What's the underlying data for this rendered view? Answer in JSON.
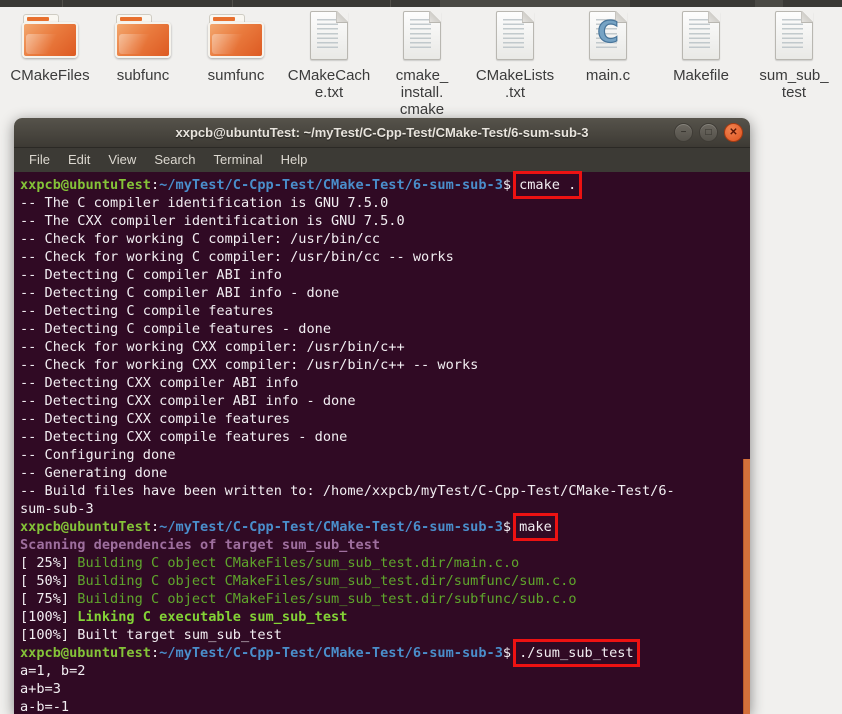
{
  "colors": {
    "desktop_bg": "#f1f0ee",
    "terminal_bg": "#300a24",
    "terminal_fg": "#f2eef2",
    "prompt_green": "#84c338",
    "path_blue": "#4a8ecb",
    "build_green": "#5fa62c",
    "bold_green": "#83d336",
    "magenta": "#9e6f9e",
    "annotation_red": "#ed1212",
    "scrollbar_orange": "#d3703b",
    "folder_orange": "#e4622c",
    "titlebar_dark": "#45423c"
  },
  "desktop": {
    "icons": [
      {
        "name": "CMakeFiles",
        "type": "folder",
        "label_lines": [
          "CMakeFiles"
        ]
      },
      {
        "name": "subfunc",
        "type": "folder",
        "label_lines": [
          "subfunc"
        ]
      },
      {
        "name": "sumfunc",
        "type": "folder",
        "label_lines": [
          "sumfunc"
        ]
      },
      {
        "name": "CMakeCache.txt",
        "type": "file",
        "label_lines": [
          "CMakeCach",
          "e.txt"
        ]
      },
      {
        "name": "cmake_install.cmake",
        "type": "file",
        "label_lines": [
          "cmake_",
          "install.",
          "cmake"
        ]
      },
      {
        "name": "CMakeLists.txt",
        "type": "file",
        "label_lines": [
          "CMakeLists",
          ".txt"
        ]
      },
      {
        "name": "main.c",
        "type": "file-c",
        "badge": "C",
        "label_lines": [
          "main.c"
        ]
      },
      {
        "name": "Makefile",
        "type": "file",
        "label_lines": [
          "Makefile"
        ]
      },
      {
        "name": "sum_sub_test",
        "type": "file",
        "label_lines": [
          "sum_sub_",
          "test"
        ]
      }
    ]
  },
  "terminal": {
    "title": "xxpcb@ubuntuTest: ~/myTest/C-Cpp-Test/CMake-Test/6-sum-sub-3",
    "window_buttons": [
      {
        "name": "minimize",
        "glyph": "−"
      },
      {
        "name": "maximize",
        "glyph": "□"
      },
      {
        "name": "close",
        "glyph": "✕"
      }
    ],
    "menu": [
      "File",
      "Edit",
      "View",
      "Search",
      "Terminal",
      "Help"
    ],
    "prompt": {
      "user": "xxpcb@ubuntuTest",
      "separator": ":",
      "path": "~/myTest/C-Cpp-Test/CMake-Test/6-sum-sub-3",
      "symbol": "$"
    },
    "commands": [
      "cmake .",
      "make",
      "./sum_sub_test"
    ],
    "lines": [
      {
        "s": [
          {
            "t": "xxpcb@ubuntuTest",
            "c": "user"
          },
          {
            "t": ":",
            "c": "plain"
          },
          {
            "t": "~/myTest/C-Cpp-Test/CMake-Test/6-sum-sub-3",
            "c": "path"
          },
          {
            "t": "$",
            "c": "plain"
          },
          {
            "t": "cmake .",
            "c": "cmd"
          }
        ]
      },
      {
        "s": [
          {
            "t": "-- The C compiler identification is GNU 7.5.0",
            "c": "plain"
          }
        ]
      },
      {
        "s": [
          {
            "t": "-- The CXX compiler identification is GNU 7.5.0",
            "c": "plain"
          }
        ]
      },
      {
        "s": [
          {
            "t": "-- Check for working C compiler: /usr/bin/cc",
            "c": "plain"
          }
        ]
      },
      {
        "s": [
          {
            "t": "-- Check for working C compiler: /usr/bin/cc -- works",
            "c": "plain"
          }
        ]
      },
      {
        "s": [
          {
            "t": "-- Detecting C compiler ABI info",
            "c": "plain"
          }
        ]
      },
      {
        "s": [
          {
            "t": "-- Detecting C compiler ABI info - done",
            "c": "plain"
          }
        ]
      },
      {
        "s": [
          {
            "t": "-- Detecting C compile features",
            "c": "plain"
          }
        ]
      },
      {
        "s": [
          {
            "t": "-- Detecting C compile features - done",
            "c": "plain"
          }
        ]
      },
      {
        "s": [
          {
            "t": "-- Check for working CXX compiler: /usr/bin/c++",
            "c": "plain"
          }
        ]
      },
      {
        "s": [
          {
            "t": "-- Check for working CXX compiler: /usr/bin/c++ -- works",
            "c": "plain"
          }
        ]
      },
      {
        "s": [
          {
            "t": "-- Detecting CXX compiler ABI info",
            "c": "plain"
          }
        ]
      },
      {
        "s": [
          {
            "t": "-- Detecting CXX compiler ABI info - done",
            "c": "plain"
          }
        ]
      },
      {
        "s": [
          {
            "t": "-- Detecting CXX compile features",
            "c": "plain"
          }
        ]
      },
      {
        "s": [
          {
            "t": "-- Detecting CXX compile features - done",
            "c": "plain"
          }
        ]
      },
      {
        "s": [
          {
            "t": "-- Configuring done",
            "c": "plain"
          }
        ]
      },
      {
        "s": [
          {
            "t": "-- Generating done",
            "c": "plain"
          }
        ]
      },
      {
        "s": [
          {
            "t": "-- Build files have been written to: /home/xxpcb/myTest/C-Cpp-Test/CMake-Test/6-",
            "c": "plain"
          }
        ]
      },
      {
        "s": [
          {
            "t": "sum-sub-3",
            "c": "plain"
          }
        ]
      },
      {
        "s": [
          {
            "t": "xxpcb@ubuntuTest",
            "c": "user"
          },
          {
            "t": ":",
            "c": "plain"
          },
          {
            "t": "~/myTest/C-Cpp-Test/CMake-Test/6-sum-sub-3",
            "c": "path"
          },
          {
            "t": "$",
            "c": "plain"
          },
          {
            "t": "make",
            "c": "cmd"
          }
        ]
      },
      {
        "s": [
          {
            "t": "Scanning dependencies of target sum_sub_test",
            "c": "magenta"
          }
        ]
      },
      {
        "s": [
          {
            "t": "[ 25%] ",
            "c": "plain"
          },
          {
            "t": "Building C object CMakeFiles/sum_sub_test.dir/main.c.o",
            "c": "green"
          }
        ]
      },
      {
        "s": [
          {
            "t": "[ 50%] ",
            "c": "plain"
          },
          {
            "t": "Building C object CMakeFiles/sum_sub_test.dir/sumfunc/sum.c.o",
            "c": "green"
          }
        ]
      },
      {
        "s": [
          {
            "t": "[ 75%] ",
            "c": "plain"
          },
          {
            "t": "Building C object CMakeFiles/sum_sub_test.dir/subfunc/sub.c.o",
            "c": "green"
          }
        ]
      },
      {
        "s": [
          {
            "t": "[100%] ",
            "c": "plain"
          },
          {
            "t": "Linking C executable sum_sub_test",
            "c": "greenb"
          }
        ]
      },
      {
        "s": [
          {
            "t": "[100%] Built target sum_sub_test",
            "c": "plain"
          }
        ]
      },
      {
        "s": [
          {
            "t": "xxpcb@ubuntuTest",
            "c": "user"
          },
          {
            "t": ":",
            "c": "plain"
          },
          {
            "t": "~/myTest/C-Cpp-Test/CMake-Test/6-sum-sub-3",
            "c": "path"
          },
          {
            "t": "$",
            "c": "plain"
          },
          {
            "t": "./sum_sub_test",
            "c": "cmd"
          }
        ]
      },
      {
        "s": [
          {
            "t": "a=1, b=2",
            "c": "plain"
          }
        ]
      },
      {
        "s": [
          {
            "t": "a+b=3",
            "c": "plain"
          }
        ]
      },
      {
        "s": [
          {
            "t": "a-b=-1",
            "c": "plain"
          }
        ]
      }
    ]
  }
}
